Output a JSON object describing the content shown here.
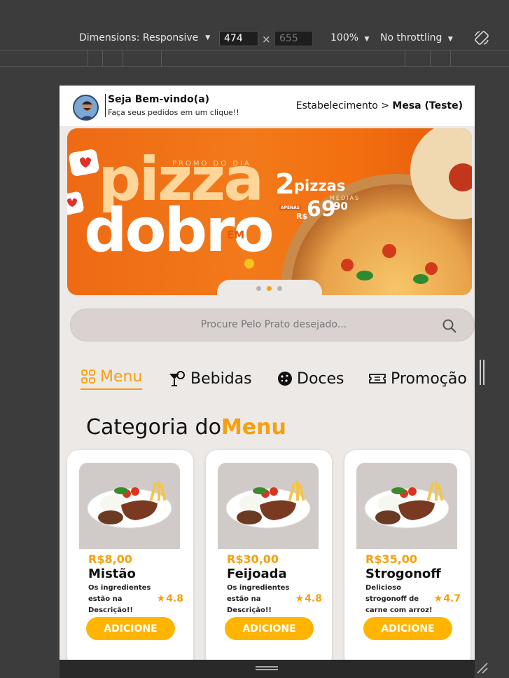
{
  "devtools": {
    "dimensions_label": "Dimensions: Responsive",
    "width_value": "474",
    "height_placeholder": "655",
    "times": "×",
    "zoom": "100%",
    "throttling": "No throttling"
  },
  "header": {
    "welcome_title": "Seja Bem-vindo(a)",
    "welcome_sub": "Faça seus pedidos em um clique!!",
    "breadcrumb_parent": "Estabelecimento",
    "breadcrumb_sep": ">",
    "breadcrumb_current": "Mesa (Teste)"
  },
  "banner": {
    "promo_label": "PROMO DO DIA",
    "headline_1": "pizza",
    "headline_2": "dobro",
    "headline_em": "EM",
    "count": "2",
    "count_label": "pizzas",
    "size_label": "MÉDIAS",
    "price_prefix": "APENAS",
    "currency": "R$",
    "price_int": "69",
    "price_cents": "90",
    "active_slide": 2,
    "slides": 3
  },
  "search": {
    "placeholder": "Procure Pelo Prato desejado..."
  },
  "tabs": [
    {
      "label": "Menu",
      "icon": "grid-icon",
      "active": true
    },
    {
      "label": "Bebidas",
      "icon": "cocktail-icon",
      "active": false
    },
    {
      "label": "Doces",
      "icon": "cookie-icon",
      "active": false
    },
    {
      "label": "Promoção",
      "icon": "ticket-icon",
      "active": false
    }
  ],
  "section": {
    "title_prefix": "Categoria do",
    "title_accent": "Menu"
  },
  "products": [
    {
      "price": "R$8,00",
      "name": "Mistão",
      "desc": "Os ingredientes estão na Descrição!!",
      "rating": "4.8",
      "button": "ADICIONE"
    },
    {
      "price": "R$30,00",
      "name": "Feijoada",
      "desc": "Os ingredientes estão na Descrição!!",
      "rating": "4.8",
      "button": "ADICIONE"
    },
    {
      "price": "R$35,00",
      "name": "Strogonoff",
      "desc": "Delicioso strogonoff de carne com arroz!",
      "rating": "4.7",
      "button": "ADICIONE"
    }
  ],
  "colors": {
    "accent": "#f5a00f",
    "button": "#ffb400",
    "banner": "#f27a1a"
  }
}
